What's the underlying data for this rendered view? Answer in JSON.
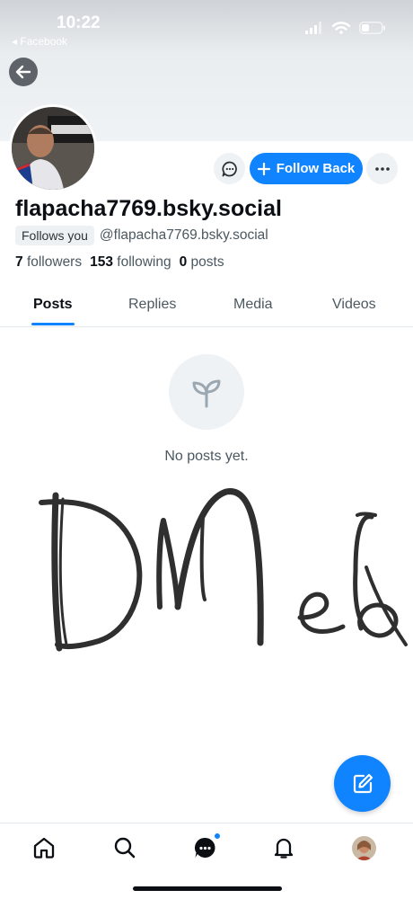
{
  "status_bar": {
    "time": "10:22",
    "back_app": "◂ Facebook"
  },
  "profile": {
    "display_name": "flapacha7769.bsky.social",
    "follows_you": "Follows you",
    "handle": "@flapacha7769.bsky.social",
    "followers_count": "7",
    "followers_label": "followers",
    "following_count": "153",
    "following_label": "following",
    "posts_count": "0",
    "posts_label": "posts"
  },
  "actions": {
    "follow_back": "Follow Back"
  },
  "tabs": [
    {
      "label": "Posts",
      "active": true
    },
    {
      "label": "Replies",
      "active": false
    },
    {
      "label": "Media",
      "active": false
    },
    {
      "label": "Videos",
      "active": false
    }
  ],
  "empty_state": {
    "text": "No posts yet."
  },
  "bottom_nav": {
    "notification_dot_on": "messages"
  },
  "colors": {
    "accent": "#1083fe",
    "muted_text": "#4b5861",
    "surface": "#eef2f5"
  }
}
